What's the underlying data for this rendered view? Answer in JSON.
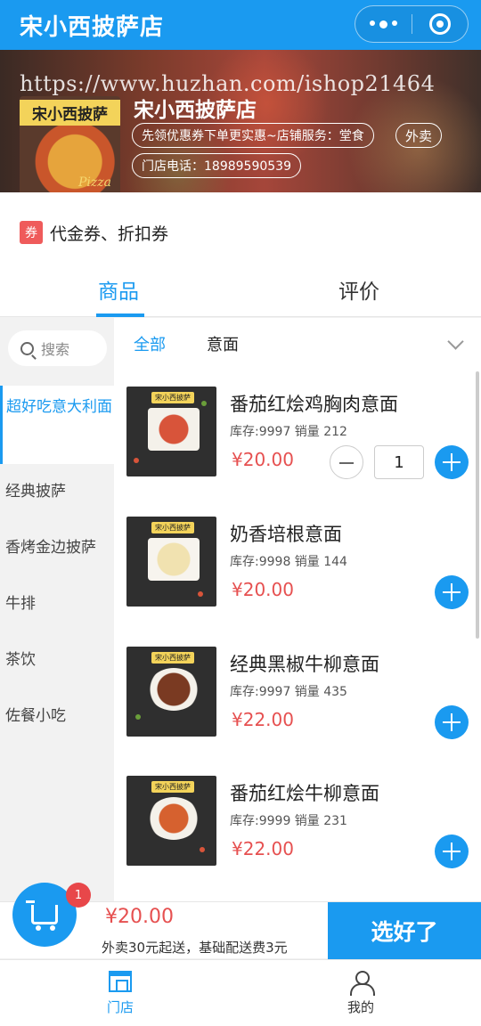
{
  "app": {
    "title": "宋小西披萨店"
  },
  "banner": {
    "watermark": "https://www.huzhan.com/ishop21464",
    "logo_text": "宋小西披萨",
    "logo_word": "Pizza",
    "store_name": "宋小西披萨店",
    "promo": "先领优惠券下单更实惠~店铺服务：堂食",
    "takeout": "外卖",
    "phone": "门店电话：18989590539"
  },
  "coupon": {
    "tag": "券",
    "text": "代金券、折扣券"
  },
  "tabs": {
    "goods": "商品",
    "review": "评价"
  },
  "sidebar": {
    "search_placeholder": "搜索",
    "categories": [
      "超好吃意大利面",
      "经典披萨",
      "香烤金边披萨",
      "牛排",
      "茶饮",
      "佐餐小吃"
    ]
  },
  "subtabs": {
    "all": "全部",
    "pasta": "意面"
  },
  "items": [
    {
      "name": "番茄红烩鸡胸肉意面",
      "meta": "库存:9997  销量 212",
      "price": "¥20.00",
      "qty": "1",
      "thumb_label": "宋小西披萨"
    },
    {
      "name": "奶香培根意面",
      "meta": "库存:9998  销量 144",
      "price": "¥20.00",
      "thumb_label": "宋小西披萨"
    },
    {
      "name": "经典黑椒牛柳意面",
      "meta": "库存:9997  销量 435",
      "price": "¥22.00",
      "thumb_label": "宋小西披萨"
    },
    {
      "name": "番茄红烩牛柳意面",
      "meta": "库存:9999  销量 231",
      "price": "¥22.00",
      "thumb_label": "宋小西披萨"
    }
  ],
  "cart": {
    "badge": "1",
    "total": "¥20.00",
    "delivery": "外卖30元起送，基础配送费3元",
    "checkout": "选好了"
  },
  "nav": {
    "store": "门店",
    "mine": "我的"
  },
  "colors": {
    "accent": "#1a9af0",
    "price": "#e65050",
    "badge": "#e8474a"
  }
}
